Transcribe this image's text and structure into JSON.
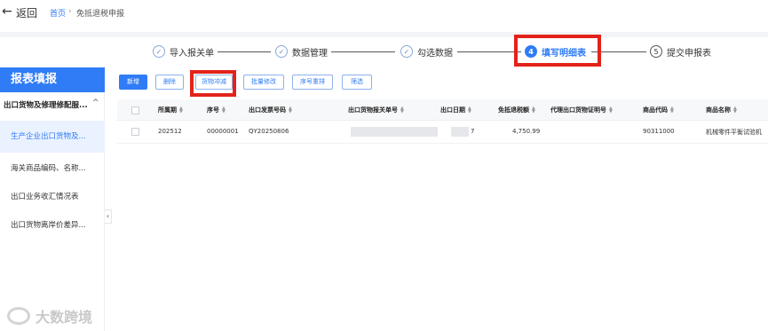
{
  "header": {
    "back_label": "返回",
    "breadcrumb_home": "首页",
    "breadcrumb_separator": "›",
    "breadcrumb_current": "免抵退税申报"
  },
  "stepper": {
    "steps": [
      {
        "index": "✓",
        "label": "导入报关单",
        "state": "done"
      },
      {
        "index": "✓",
        "label": "数据管理",
        "state": "done"
      },
      {
        "index": "✓",
        "label": "勾选数据",
        "state": "done"
      },
      {
        "index": "4",
        "label": "填写明细表",
        "state": "active"
      },
      {
        "index": "5",
        "label": "提交申报表",
        "state": "pending"
      }
    ]
  },
  "sidebar": {
    "title": "报表填报",
    "group_label": "出口货物及修理修配服...",
    "items": [
      {
        "label": "生产企业出口货物及...",
        "active": true
      },
      {
        "label": "海关商品编码、名称...",
        "active": false
      },
      {
        "label": "出口业务收汇情况表",
        "active": false
      },
      {
        "label": "出口货物离岸价差异...",
        "active": false
      }
    ]
  },
  "toolbar": {
    "new_label": "新增",
    "delete_label": "删除",
    "offset_label": "货物冲减",
    "batch_edit_label": "批量修改",
    "reorder_label": "序号重排",
    "filter_label": "筛选"
  },
  "table": {
    "columns": [
      "所属期",
      "序号",
      "出口发票号码",
      "出口货物报关单号",
      "出口日期",
      "免抵退税额",
      "代理出口货物证明号",
      "商品代码",
      "商品名称"
    ],
    "rows": [
      {
        "period": "202512",
        "seq": "00000001",
        "invoice_no": "QY20250806",
        "customs_no": "",
        "export_date": "7",
        "refund_amount": "4,750.99",
        "agency_cert": "",
        "goods_code": "90311000",
        "goods_name": "机械零件平衡试验机"
      }
    ]
  },
  "watermark": "大数跨境",
  "colors": {
    "accent": "#2f7cf6",
    "highlight": "#e2231a",
    "sidebar_active_bg": "#eaf2ff"
  }
}
